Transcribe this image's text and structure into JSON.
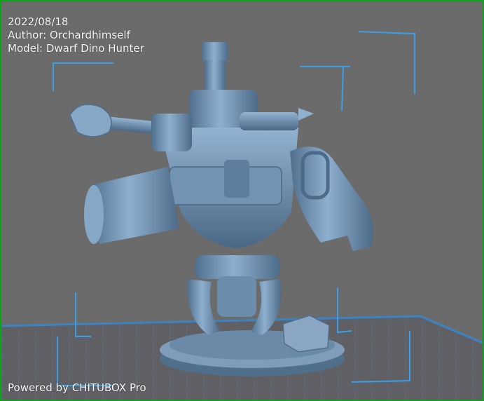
{
  "app": {
    "name": "CHITUBOX Pro"
  },
  "info": {
    "date": "2022/08/18",
    "author": "Author: Orchardhimself",
    "model": "Model: Dwarf Dino Hunter"
  },
  "watermark": "Powered by CHITUBOX Pro",
  "colors": {
    "frame": "#0fa11a",
    "background": "#6b6b6b",
    "model": "#7b9cba",
    "grid": "#5c7f9c",
    "bounding_box": "#3aa0e8"
  }
}
